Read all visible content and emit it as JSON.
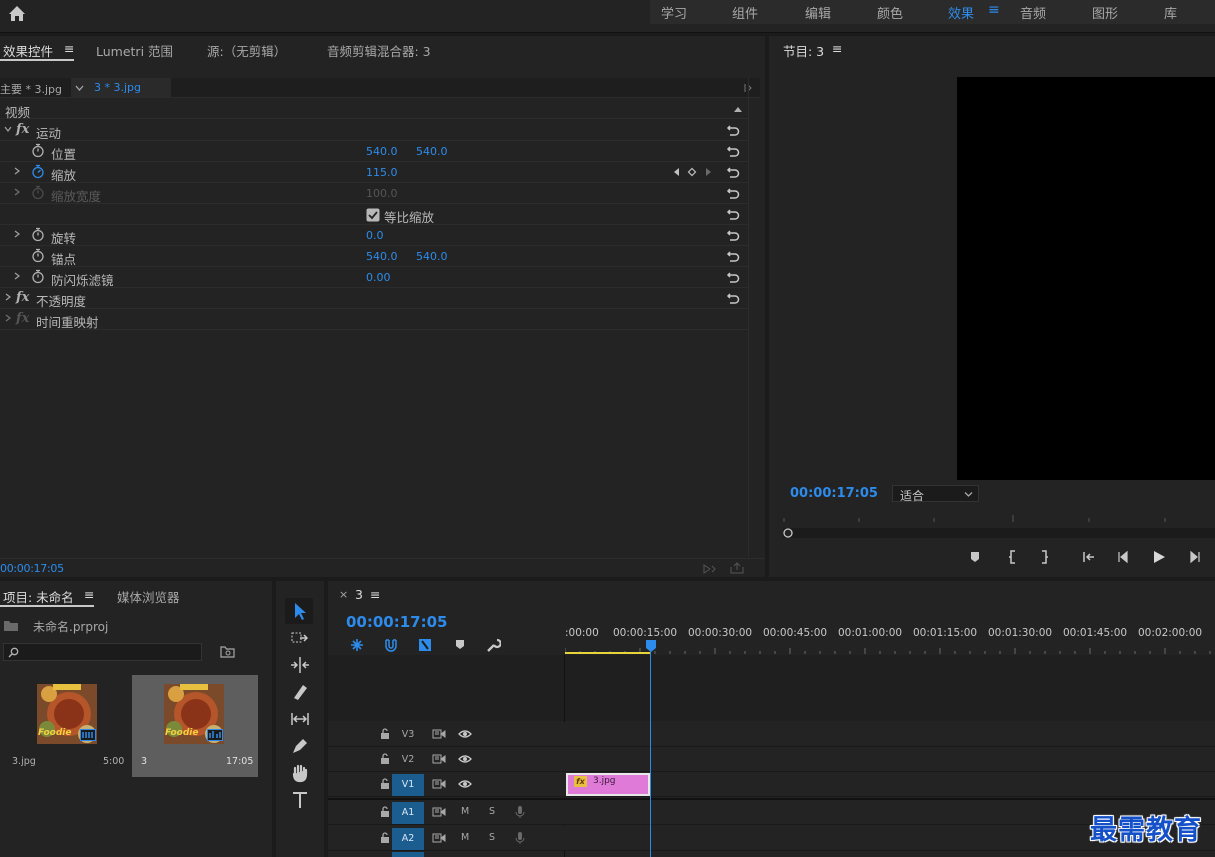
{
  "topbar": {
    "workspaces": [
      "学习",
      "组件",
      "编辑",
      "颜色",
      "效果",
      "音频",
      "图形",
      "库"
    ],
    "active_workspace": "效果",
    "menu_glyph": "≡",
    "home_icon": "home-icon"
  },
  "effects_panel": {
    "tabs": [
      "效果控件",
      "Lumetri 范围",
      "源:（无剪辑）",
      "音频剪辑混合器: 3"
    ],
    "tab_menu_glyph": "≡",
    "master_label": "主要 * 3.jpg",
    "clip_label": "3 * 3.jpg",
    "section": "视频",
    "rows": [
      {
        "label": "运动",
        "fx": "fx"
      },
      {
        "label": "位置",
        "v1": "540.0",
        "v2": "540.0"
      },
      {
        "label": "缩放",
        "v1": "115.0"
      },
      {
        "label": "缩放宽度",
        "v1": "100.0"
      },
      {
        "label": "等比缩放"
      },
      {
        "label": "旋转",
        "v1": "0.0"
      },
      {
        "label": "锚点",
        "v1": "540.0",
        "v2": "540.0"
      },
      {
        "label": "防闪烁滤镜",
        "v1": "0.00"
      },
      {
        "label": "不透明度",
        "fx": "fx"
      },
      {
        "label": "时间重映射",
        "fx": "fx"
      }
    ],
    "timecode": "00:00:17:05"
  },
  "program_monitor": {
    "title": "节目: 3",
    "menu_glyph": "≡",
    "timecode": "00:00:17:05",
    "fit_option": "适合"
  },
  "project_panel": {
    "tabs": [
      "项目: 未命名",
      "媒体浏览器"
    ],
    "menu_glyph": "≡",
    "project_file": "未命名.prproj",
    "items": [
      {
        "name": "3.jpg",
        "duration": "5:00"
      },
      {
        "name": "3",
        "duration": "17:05"
      }
    ],
    "thumb_text": "Foodie"
  },
  "timeline": {
    "close_glyph": "×",
    "sequence_name": "3",
    "menu_glyph": "≡",
    "timecode": "00:00:17:05",
    "ruler": [
      ":00:00",
      "00:00:15:00",
      "00:00:30:00",
      "00:00:45:00",
      "00:01:00:00",
      "00:01:15:00",
      "00:01:30:00",
      "00:01:45:00",
      "00:02:00:00"
    ],
    "tracks": [
      {
        "name": "V3"
      },
      {
        "name": "V2"
      },
      {
        "name": "V1"
      },
      {
        "name": "A1"
      },
      {
        "name": "A2"
      }
    ],
    "mute_label": "M",
    "solo_label": "S",
    "clip_name": "3.jpg",
    "clip_fx": "fx",
    "colors": {
      "accent": "#2d8ceb",
      "clip": "#e07ad8",
      "playhead": "#2d8ceb",
      "workarea": "#e8d33a"
    }
  },
  "watermark": "最需教育"
}
